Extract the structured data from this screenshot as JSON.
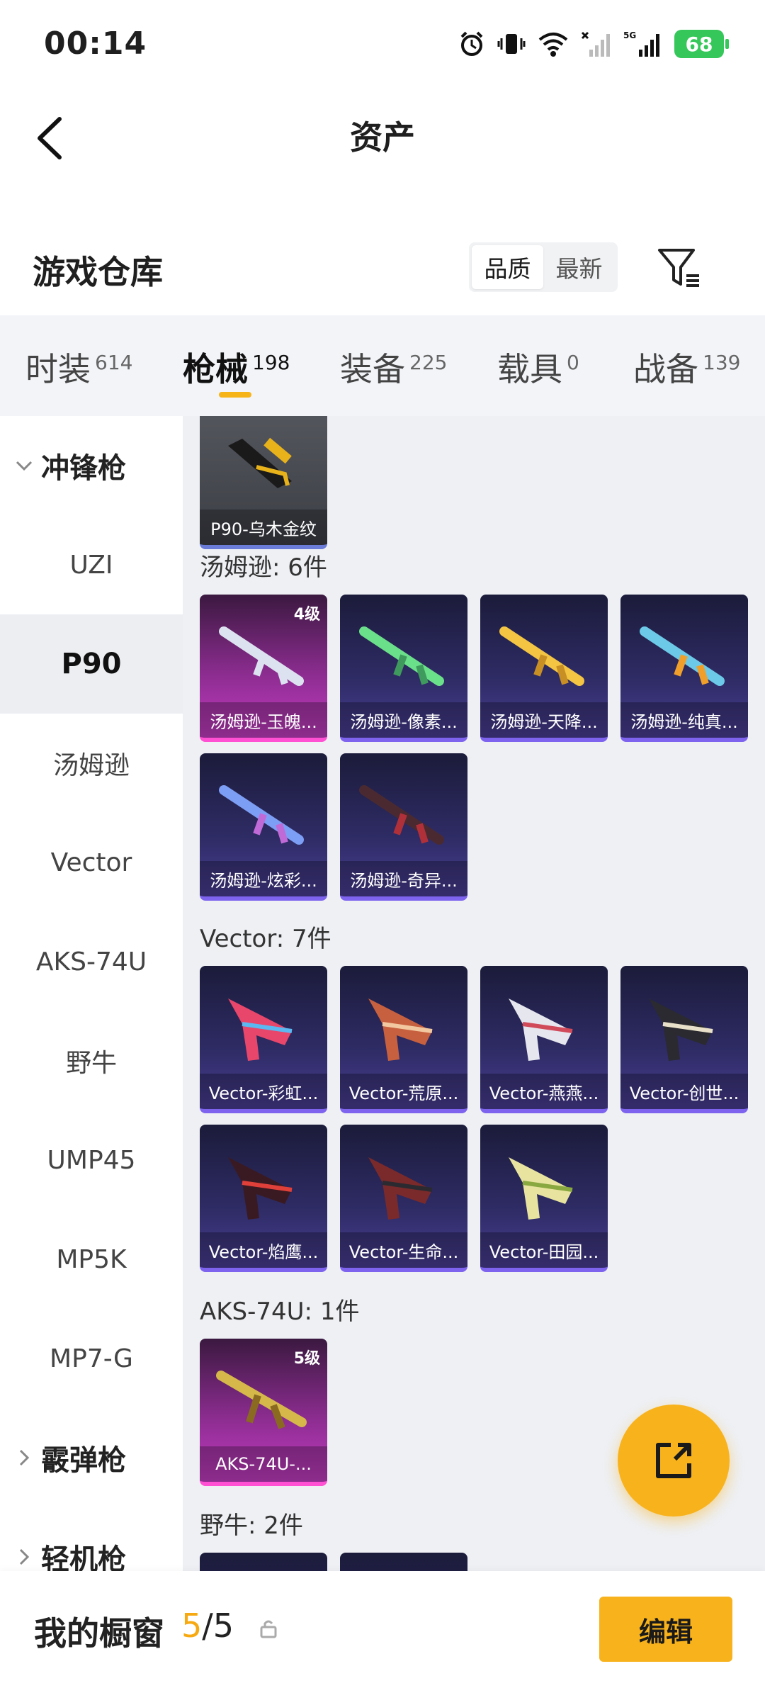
{
  "status_bar": {
    "time": "00:14",
    "battery": "68"
  },
  "header": {
    "title": "资产"
  },
  "section": {
    "title": "游戏仓库"
  },
  "sort": {
    "quality": "品质",
    "latest": "最新",
    "active": "quality"
  },
  "tabs": [
    {
      "label": "时装",
      "count": "614"
    },
    {
      "label": "枪械",
      "count": "198"
    },
    {
      "label": "装备",
      "count": "225"
    },
    {
      "label": "载具",
      "count": "0"
    },
    {
      "label": "战备",
      "count": "139"
    }
  ],
  "sidebar": {
    "group_smg": "冲锋枪",
    "items": [
      "UZI",
      "P90",
      "汤姆逊",
      "Vector",
      "AKS-74U",
      "野牛",
      "UMP45",
      "MP5K",
      "MP7-G"
    ],
    "active_item": "P90",
    "group_shotgun": "霰弹枪",
    "group_lmg": "轻机枪"
  },
  "content": {
    "top_card": {
      "label": "P90-乌木金纹"
    },
    "groups": [
      {
        "title": "汤姆逊: 6件",
        "items": [
          {
            "label": "汤姆逊-玉魄...",
            "level": "4级"
          },
          {
            "label": "汤姆逊-像素..."
          },
          {
            "label": "汤姆逊-天降..."
          },
          {
            "label": "汤姆逊-纯真..."
          },
          {
            "label": "汤姆逊-炫彩..."
          },
          {
            "label": "汤姆逊-奇异..."
          }
        ]
      },
      {
        "title": "Vector: 7件",
        "items": [
          {
            "label": "Vector-彩虹..."
          },
          {
            "label": "Vector-荒原..."
          },
          {
            "label": "Vector-燕燕..."
          },
          {
            "label": "Vector-创世..."
          },
          {
            "label": "Vector-焰鹰..."
          },
          {
            "label": "Vector-生命..."
          },
          {
            "label": "Vector-田园..."
          }
        ]
      },
      {
        "title": "AKS-74U: 1件",
        "items": [
          {
            "label": "AKS-74U-...",
            "level": "5级"
          }
        ]
      },
      {
        "title": "野牛: 2件",
        "items": []
      }
    ]
  },
  "bottom": {
    "title": "我的橱窗",
    "current": "5",
    "separator": "/",
    "total": "5",
    "edit_label": "编辑"
  },
  "colors": {
    "accent": "#f8b21b",
    "card_purple": "#2f2c66",
    "card_pink": "#c43dc3",
    "battery": "#35c759"
  }
}
